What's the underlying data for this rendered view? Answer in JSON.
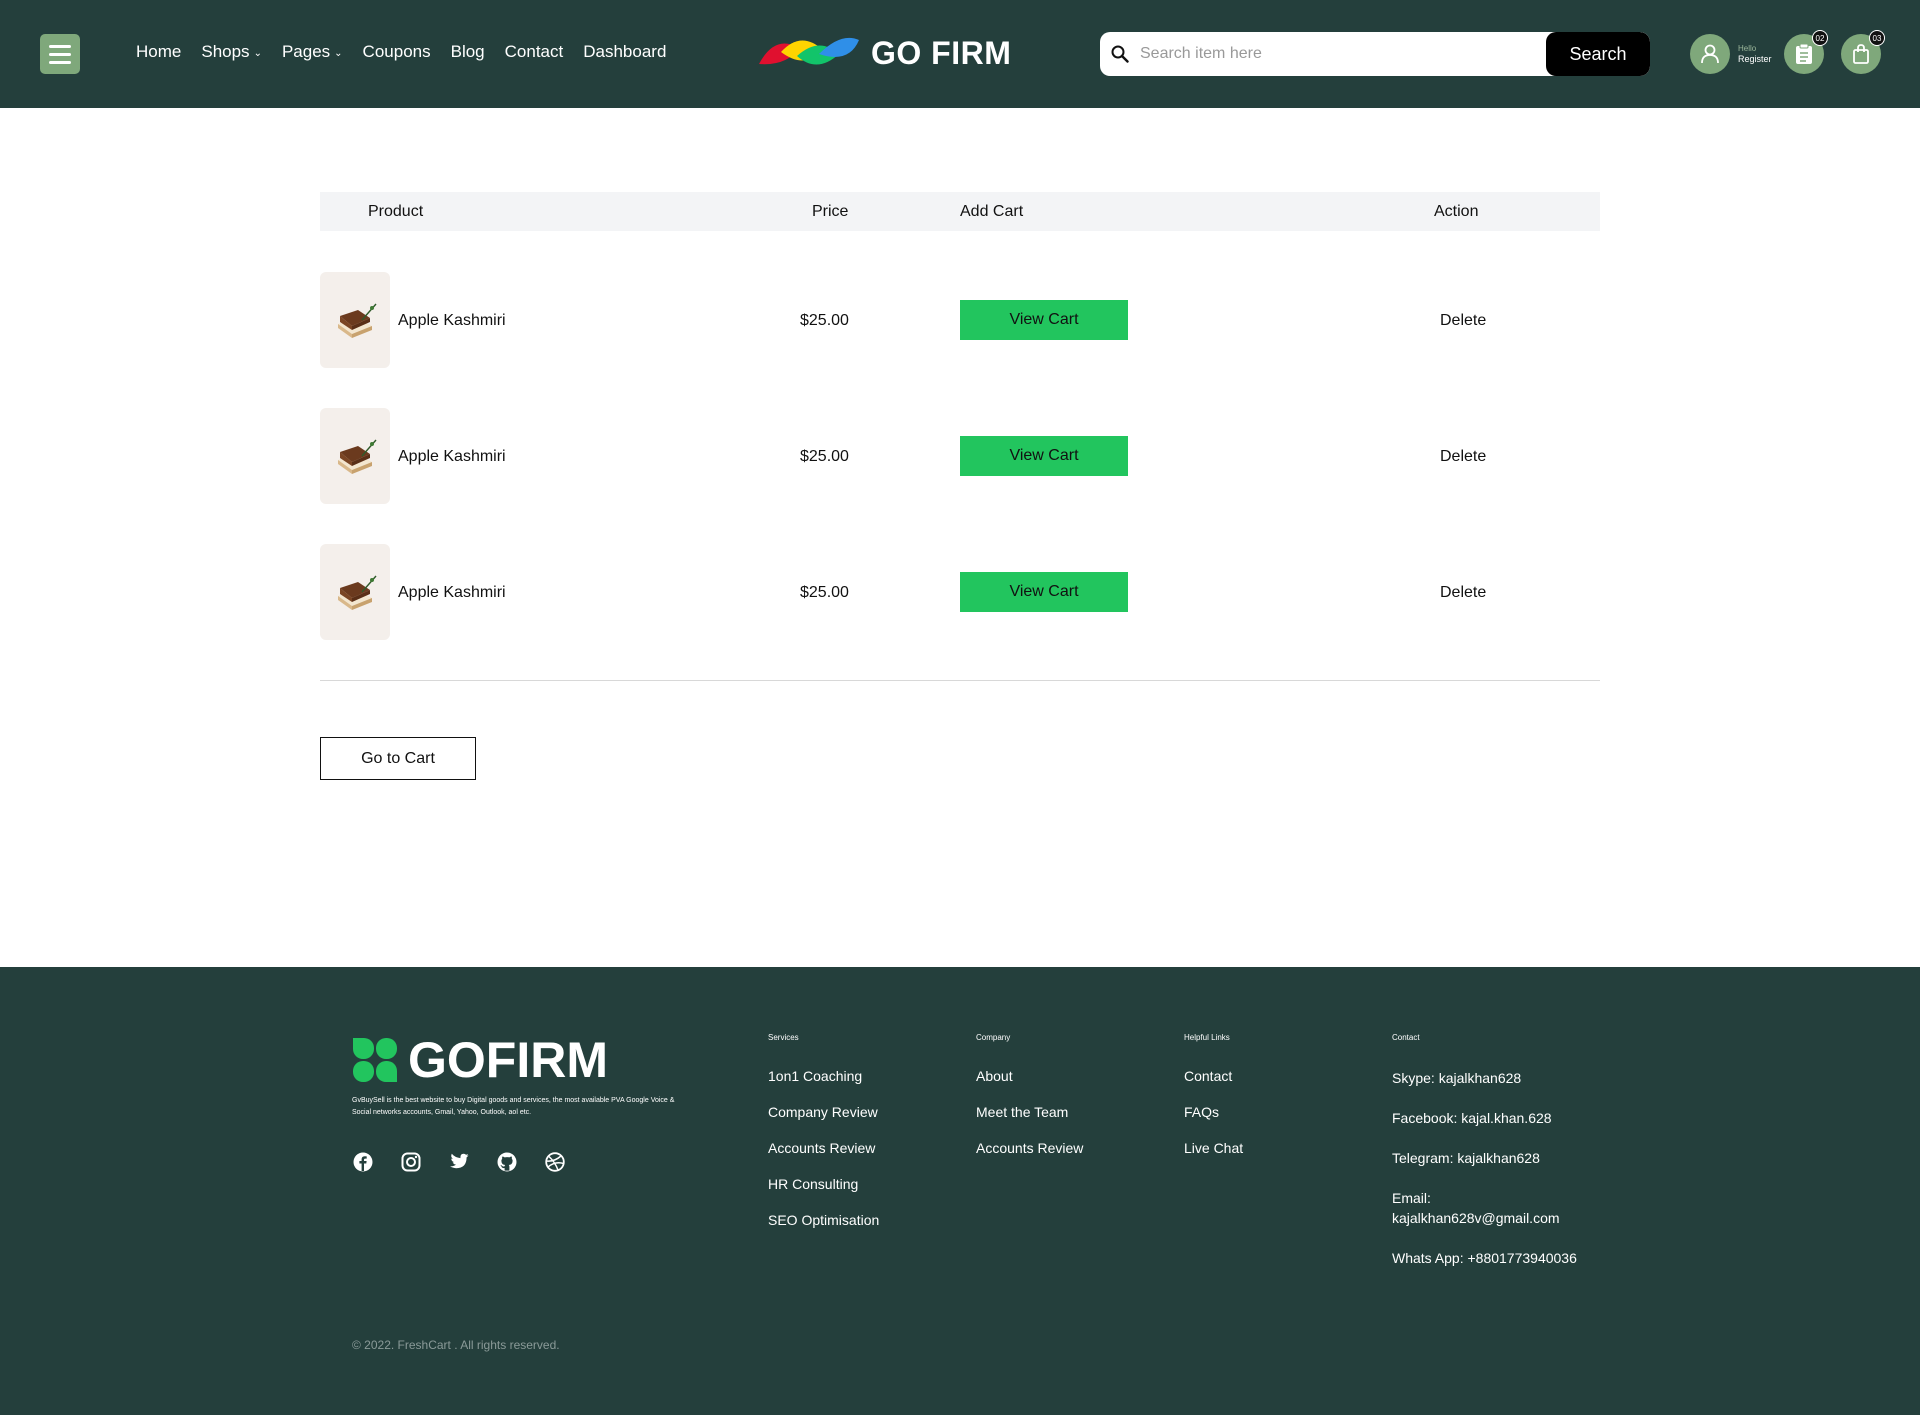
{
  "header": {
    "nav": [
      {
        "label": "Home",
        "dropdown": false
      },
      {
        "label": "Shops",
        "dropdown": true
      },
      {
        "label": "Pages",
        "dropdown": true
      },
      {
        "label": "Coupons",
        "dropdown": false
      },
      {
        "label": "Blog",
        "dropdown": false
      },
      {
        "label": "Contact",
        "dropdown": false
      },
      {
        "label": "Dashboard",
        "dropdown": false
      }
    ],
    "logo_text": "GO FIRM",
    "search": {
      "placeholder": "Search item here",
      "button_label": "Search"
    },
    "user": {
      "hello": "Hello",
      "register": "Register"
    },
    "list_badge": "02",
    "bag_badge": "03",
    "colors": {
      "header_bg": "#243f3c",
      "accent": "#7fa87b"
    }
  },
  "table": {
    "headers": {
      "product": "Product",
      "price": "Price",
      "add_cart": "Add Cart",
      "action": "Action"
    },
    "rows": [
      {
        "name": "Apple Kashmiri",
        "price": "$25.00",
        "button": "View Cart",
        "action": "Delete"
      },
      {
        "name": "Apple Kashmiri",
        "price": "$25.00",
        "button": "View Cart",
        "action": "Delete"
      },
      {
        "name": "Apple Kashmiri",
        "price": "$25.00",
        "button": "View Cart",
        "action": "Delete"
      }
    ],
    "go_to_cart": "Go to Cart",
    "button_color": "#22c55e"
  },
  "footer": {
    "logo_text": "GOFIRM",
    "description": "GvBuySell is the best website to buy Digital goods and services, the most available PVA Google Voice & Social networks accounts, Gmail, Yahoo, Outlook, aol etc.",
    "socials": [
      "facebook-icon",
      "instagram-icon",
      "twitter-icon",
      "github-icon",
      "dribbble-icon"
    ],
    "services": {
      "title": "Services",
      "links": [
        "1on1 Coaching",
        "Company Review",
        "Accounts Review",
        "HR Consulting",
        "SEO Optimisation"
      ]
    },
    "company": {
      "title": "Company",
      "links": [
        "About",
        "Meet the Team",
        "Accounts Review"
      ]
    },
    "helpful": {
      "title": "Helpful Links",
      "links": [
        "Contact",
        "FAQs",
        "Live Chat"
      ]
    },
    "contact": {
      "title": "Contact",
      "items": [
        "Skype: kajalkhan628",
        "Facebook: kajal.khan.628",
        "Telegram: kajalkhan628",
        "Email: kajalkhan628v@gmail.com",
        "Whats App: +8801773940036"
      ]
    },
    "copyright": "© 2022. FreshCart . All rights reserved."
  }
}
